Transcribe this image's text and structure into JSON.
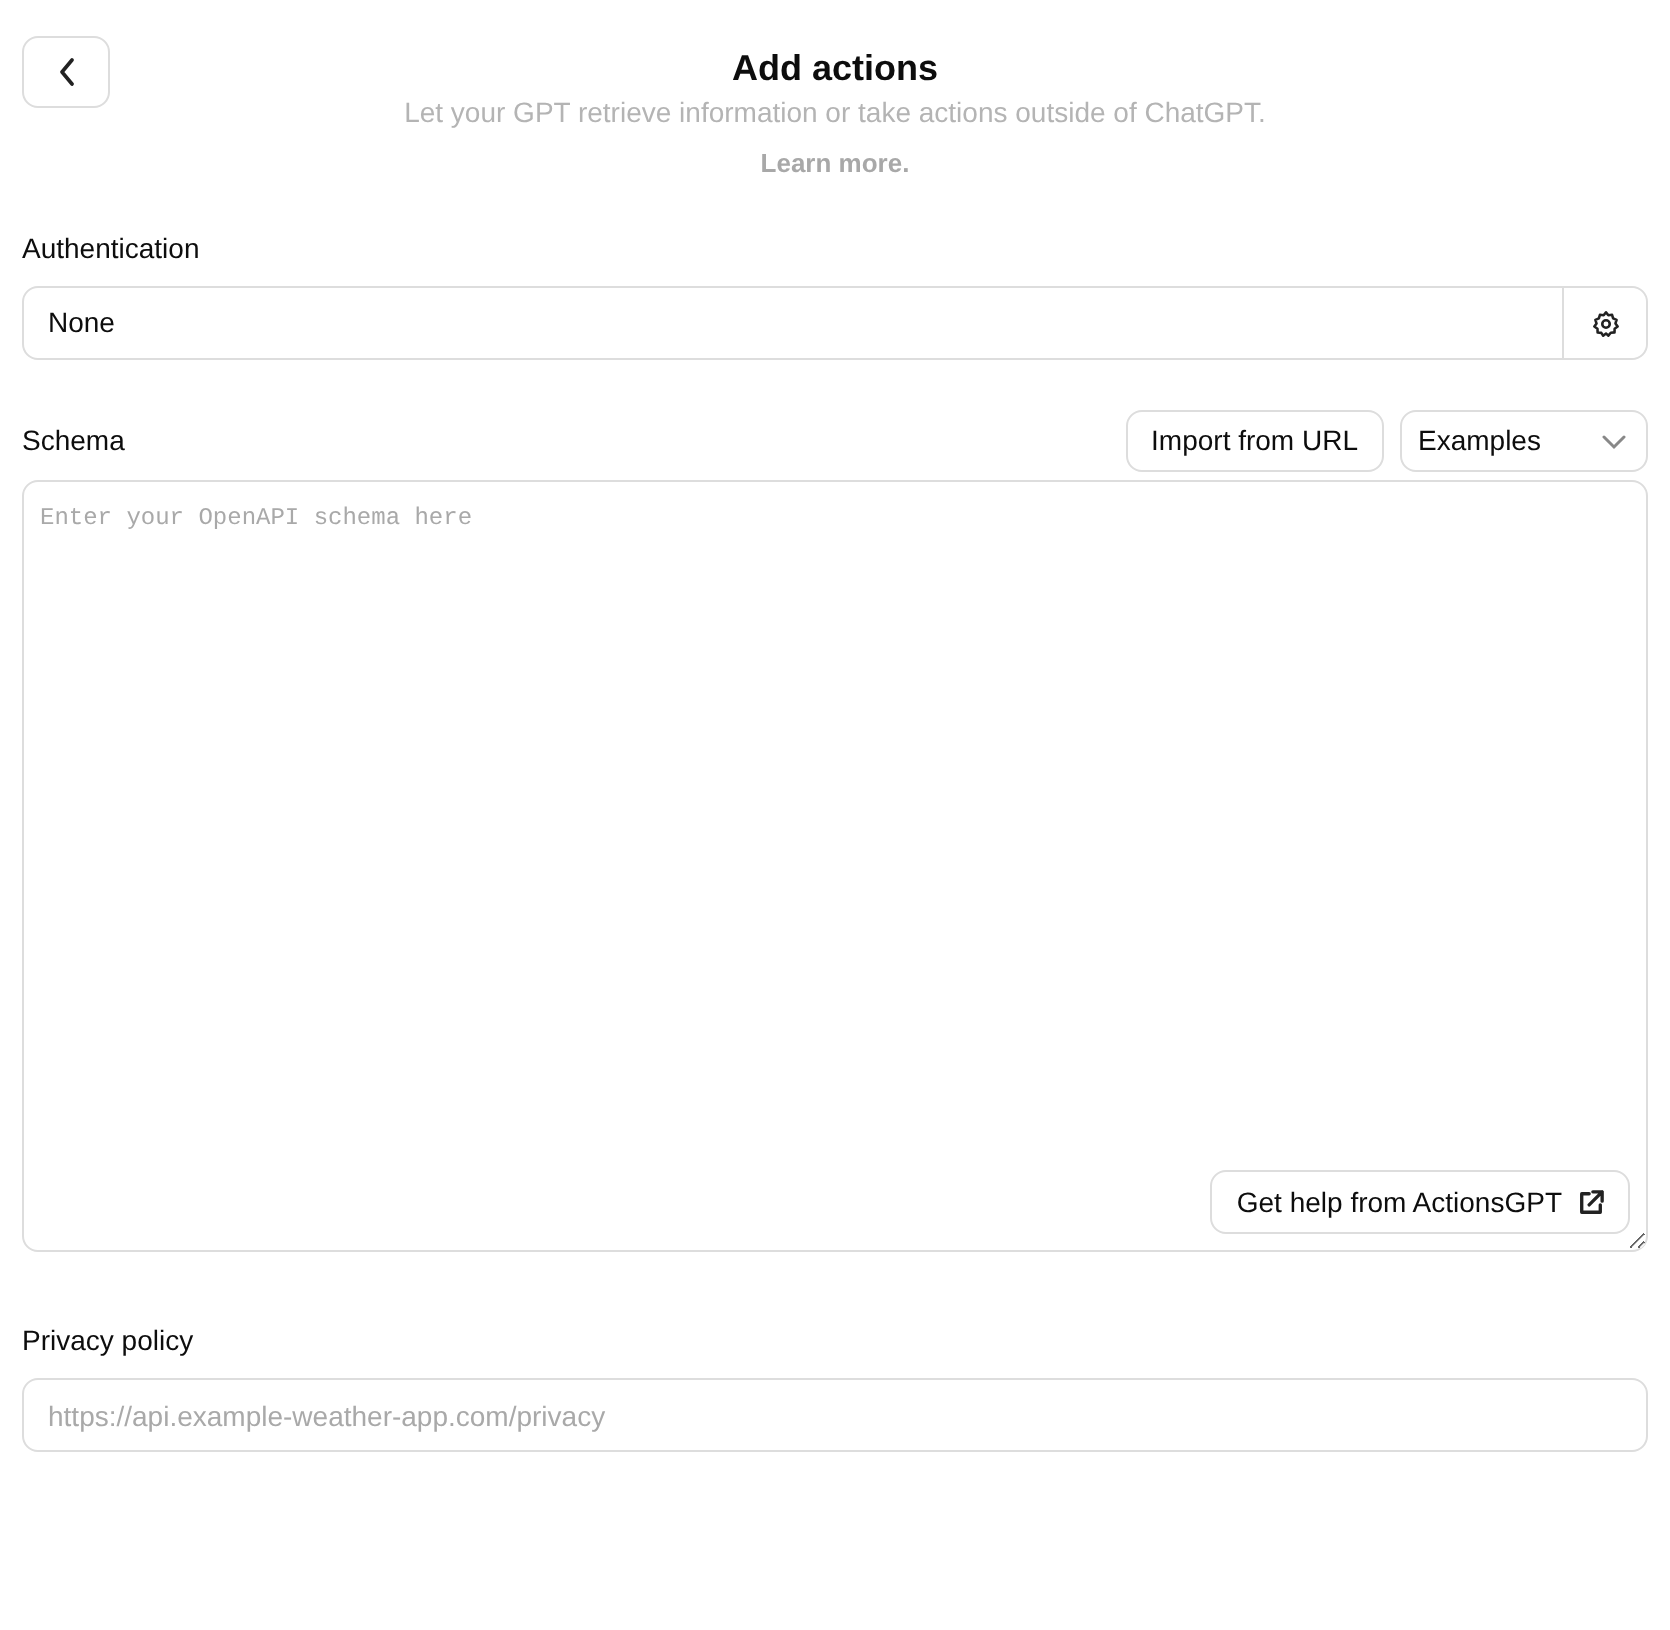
{
  "header": {
    "title": "Add actions",
    "subtitle": "Let your GPT retrieve information or take actions outside of ChatGPT.",
    "learn_more": "Learn more."
  },
  "authentication": {
    "label": "Authentication",
    "value": "None"
  },
  "schema": {
    "label": "Schema",
    "import_button": "Import from URL",
    "examples_select": "Examples",
    "placeholder": "Enter your OpenAPI schema here",
    "help_button": "Get help from ActionsGPT"
  },
  "privacy_policy": {
    "label": "Privacy policy",
    "placeholder": "https://api.example-weather-app.com/privacy"
  }
}
